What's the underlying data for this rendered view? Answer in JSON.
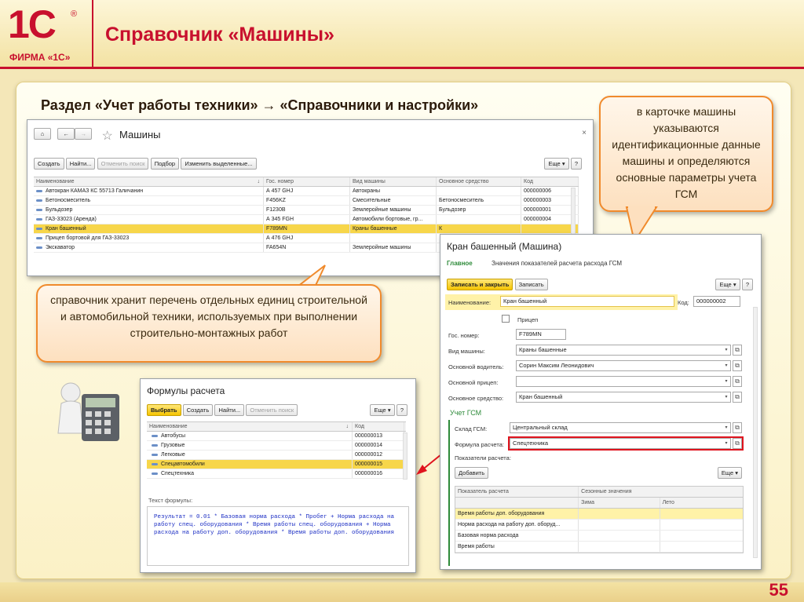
{
  "logo": {
    "mark": "1С",
    "reg": "®",
    "firm": "ФИРМА «1С»"
  },
  "slide": {
    "title": "Справочник «Машины»",
    "subtitle": "Раздел «Учет работы техники» → «Справочники и настройки»",
    "page_number": "55"
  },
  "callouts": {
    "top_right": "в карточке машины указываются идентификационные данные машины и определяются основные параметры учета ГСМ",
    "left": "справочник хранит перечень отдельных единиц строительной и автомобильной техники, используемых при выполнении строительно-монтажных работ"
  },
  "machines_window": {
    "title": "Машины",
    "buttons": {
      "create": "Создать",
      "find": "Найти...",
      "cancel_search": "Отменить поиск",
      "pick": "Подбор",
      "edit_selected": "Изменить выделенные...",
      "more": "Еще",
      "help": "?"
    },
    "columns": [
      "Наименование",
      "Гос. номер",
      "Вид машины",
      "Основное средство",
      "Код"
    ],
    "rows": [
      [
        "Автокран КАМАЗ КС 55713 Галичанин",
        "А 457 GHJ",
        "Автокраны",
        "",
        "000000006"
      ],
      [
        "Бетоносмеситель",
        "F456KZ",
        "Смесительные",
        "Бетоносмеситель",
        "000000003"
      ],
      [
        "Бульдозер",
        "F1230B",
        "Землеройные машины",
        "Бульдозер",
        "000000001"
      ],
      [
        "ГАЗ-33023 (Аренда)",
        "А 345 FGH",
        "Автомобили бортовые, гр...",
        "",
        "000000004"
      ],
      [
        "Кран башенный",
        "F789MN",
        "Краны башенные",
        "К",
        ""
      ],
      [
        "Прицеп бортовой для ГАЗ-33023",
        "А 476 GHJ",
        "",
        "",
        ""
      ],
      [
        "Экскаватор",
        "FA654N",
        "Землеройные машины",
        "",
        ""
      ]
    ],
    "selected_row": 4
  },
  "formulas_window": {
    "title": "Формулы расчета",
    "buttons": {
      "select": "Выбрать",
      "create": "Создать",
      "find": "Найти...",
      "cancel_search": "Отменить поиск",
      "more": "Еще",
      "help": "?"
    },
    "columns": [
      "Наименование",
      "Код"
    ],
    "rows": [
      [
        "Автобусы",
        "000000013"
      ],
      [
        "Грузовые",
        "000000014"
      ],
      [
        "Легковые",
        "000000012"
      ],
      [
        "Спецавтомобили",
        "000000015"
      ],
      [
        "Спецтехника",
        "000000016"
      ]
    ],
    "selected_row": 3,
    "formula_label": "Текст формулы:",
    "formula_text": "Результат = 0.01 * Базовая норма расхода * Пробег + Норма расхода на работу спец. оборудования * Время работы спец. оборудования + Норма расхода на работу доп. оборудования * Время работы доп. оборудования"
  },
  "card_window": {
    "title": "Кран башенный (Машина)",
    "tab_main": "Главное",
    "tab_params": "Значения показателей расчета расхода ГСМ",
    "buttons": {
      "save_close": "Записать и закрыть",
      "save": "Записать",
      "more": "Еще",
      "help": "?",
      "add": "Добавить"
    },
    "labels": {
      "name": "Наименование:",
      "code": "Код:",
      "trailer": "Прицеп",
      "gos": "Гос. номер:",
      "kind": "Вид машины:",
      "driver": "Основной водитель:",
      "main_trailer": "Основной прицеп:",
      "asset": "Основное средство:",
      "fuel_section": "Учет ГСМ",
      "warehouse": "Склад ГСМ:",
      "formula": "Формула расчета:",
      "indicators": "Показатели расчета:"
    },
    "values": {
      "name": "Кран башенный",
      "code": "000000002",
      "gos": "F789MN",
      "kind": "Краны башенные",
      "driver": "Сорин Максим Леонидович",
      "main_trailer": "",
      "asset": "Кран башенный",
      "warehouse": "Центральный склад",
      "formula": "Спецтехника"
    },
    "table": {
      "col_indicator": "Показатель расчета",
      "col_season": "Сезонные значения",
      "col_winter": "Зима",
      "col_summer": "Лето",
      "rows": [
        "Время работы доп. оборудования",
        "Норма расхода на работу доп. оборуд...",
        "Базовая норма расхода",
        "Время работы"
      ],
      "selected_row": 0
    }
  },
  "colors": {
    "brand_red": "#c8102e",
    "selection_yellow": "#f7d64a",
    "callout_orange": "#f08a2c",
    "highlight_red": "#e0141e",
    "form_green": "#2e8b3a"
  }
}
